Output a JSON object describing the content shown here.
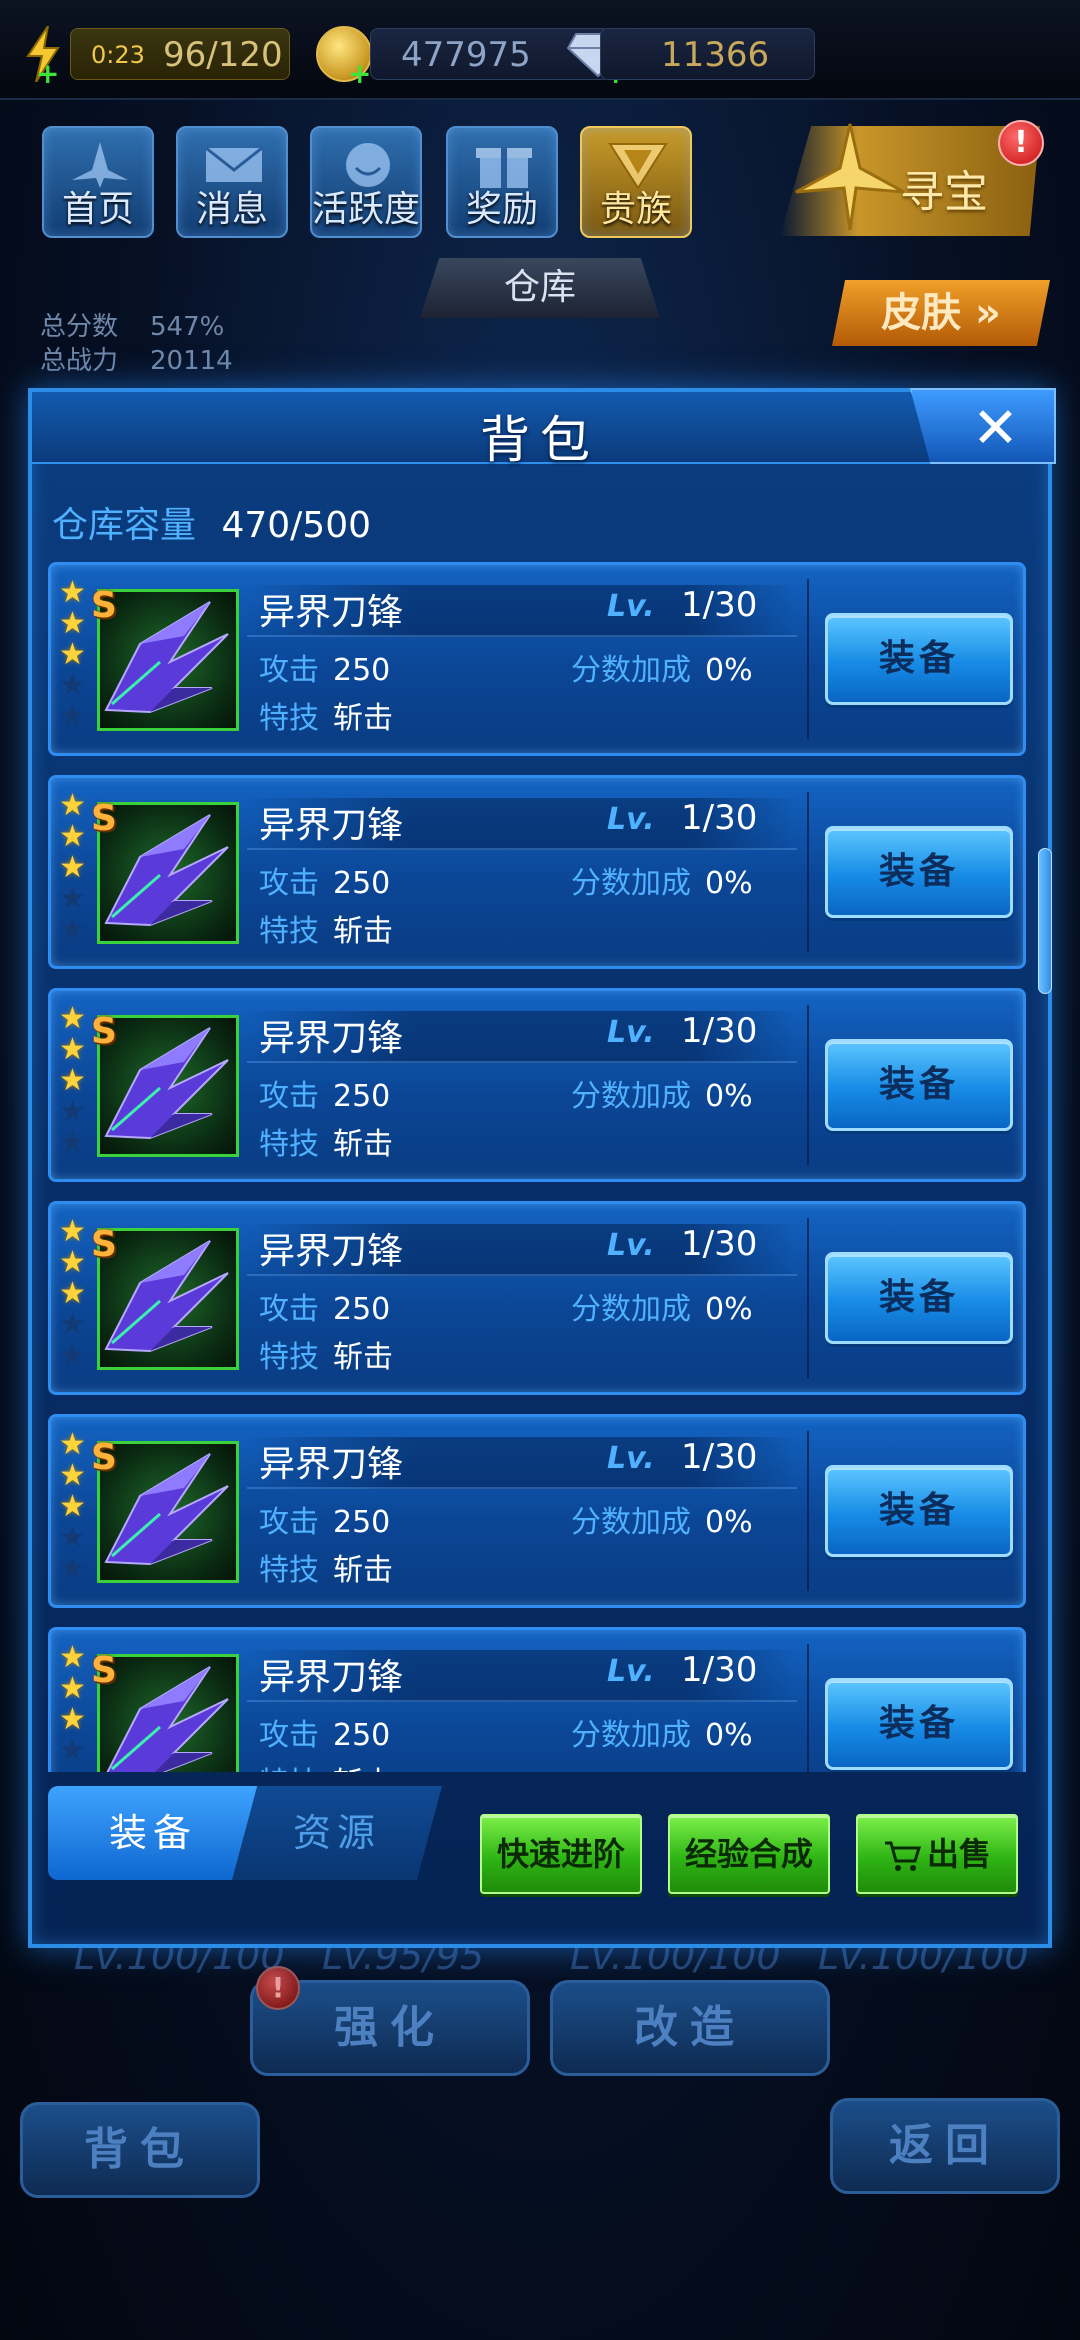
{
  "topbar": {
    "energy_timer": "0:23",
    "energy": "96/120",
    "gold": "477975",
    "gems": "11366"
  },
  "menu": {
    "items": [
      {
        "label": "首页"
      },
      {
        "label": "消息"
      },
      {
        "label": "活跃度"
      },
      {
        "label": "奖励"
      },
      {
        "label": "贵族"
      }
    ],
    "treasure_label": "寻宝",
    "treasure_badge": "!"
  },
  "background": {
    "warehouse_tab": "仓库",
    "skin_button": "皮肤",
    "total_score_label": "总分数",
    "total_score": "547%",
    "total_power_label": "总战力",
    "total_power": "20114",
    "levels": [
      "Lv.100/100",
      "Lv.95/95",
      "Lv.100/100",
      "Lv.100/100"
    ],
    "enhance_button": "强化",
    "modify_button": "改造",
    "bag_button": "背包",
    "back_button": "返回",
    "enhance_badge": "!"
  },
  "modal": {
    "title": "背包",
    "close_symbol": "✕",
    "capacity_label": "仓库容量",
    "capacity_value": "470/500",
    "items": [
      {
        "name": "异界刀锋",
        "lv_label": "Lv.",
        "lv": "1/30",
        "attack_label": "攻击",
        "attack": "250",
        "bonus_label": "分数加成",
        "bonus": "0%",
        "skill_label": "特技",
        "skill": "斩击",
        "rank": "S",
        "stars": 3,
        "max_stars": 5,
        "button": "装备"
      },
      {
        "name": "异界刀锋",
        "lv_label": "Lv.",
        "lv": "1/30",
        "attack_label": "攻击",
        "attack": "250",
        "bonus_label": "分数加成",
        "bonus": "0%",
        "skill_label": "特技",
        "skill": "斩击",
        "rank": "S",
        "stars": 3,
        "max_stars": 5,
        "button": "装备"
      },
      {
        "name": "异界刀锋",
        "lv_label": "Lv.",
        "lv": "1/30",
        "attack_label": "攻击",
        "attack": "250",
        "bonus_label": "分数加成",
        "bonus": "0%",
        "skill_label": "特技",
        "skill": "斩击",
        "rank": "S",
        "stars": 3,
        "max_stars": 5,
        "button": "装备"
      },
      {
        "name": "异界刀锋",
        "lv_label": "Lv.",
        "lv": "1/30",
        "attack_label": "攻击",
        "attack": "250",
        "bonus_label": "分数加成",
        "bonus": "0%",
        "skill_label": "特技",
        "skill": "斩击",
        "rank": "S",
        "stars": 3,
        "max_stars": 5,
        "button": "装备"
      },
      {
        "name": "异界刀锋",
        "lv_label": "Lv.",
        "lv": "1/30",
        "attack_label": "攻击",
        "attack": "250",
        "bonus_label": "分数加成",
        "bonus": "0%",
        "skill_label": "特技",
        "skill": "斩击",
        "rank": "S",
        "stars": 3,
        "max_stars": 5,
        "button": "装备"
      },
      {
        "name": "异界刀锋",
        "lv_label": "Lv.",
        "lv": "1/30",
        "attack_label": "攻击",
        "attack": "250",
        "bonus_label": "分数加成",
        "bonus": "0%",
        "skill_label": "特技",
        "skill": "斩击",
        "rank": "S",
        "stars": 3,
        "max_stars": 5,
        "button": "装备"
      }
    ],
    "tabs": [
      {
        "label": "装备",
        "active": true
      },
      {
        "label": "资源",
        "active": false
      }
    ],
    "actions": {
      "quick_advance": "快速进阶",
      "exp_merge": "经验合成",
      "sell": "出售"
    }
  },
  "colors": {
    "accent_blue": "#4fb1ff",
    "frame_blue": "#2f8cf0",
    "action_green": "#2fb515",
    "star_gold": "#ffd43a",
    "rank_orange": "#ffb23a"
  }
}
